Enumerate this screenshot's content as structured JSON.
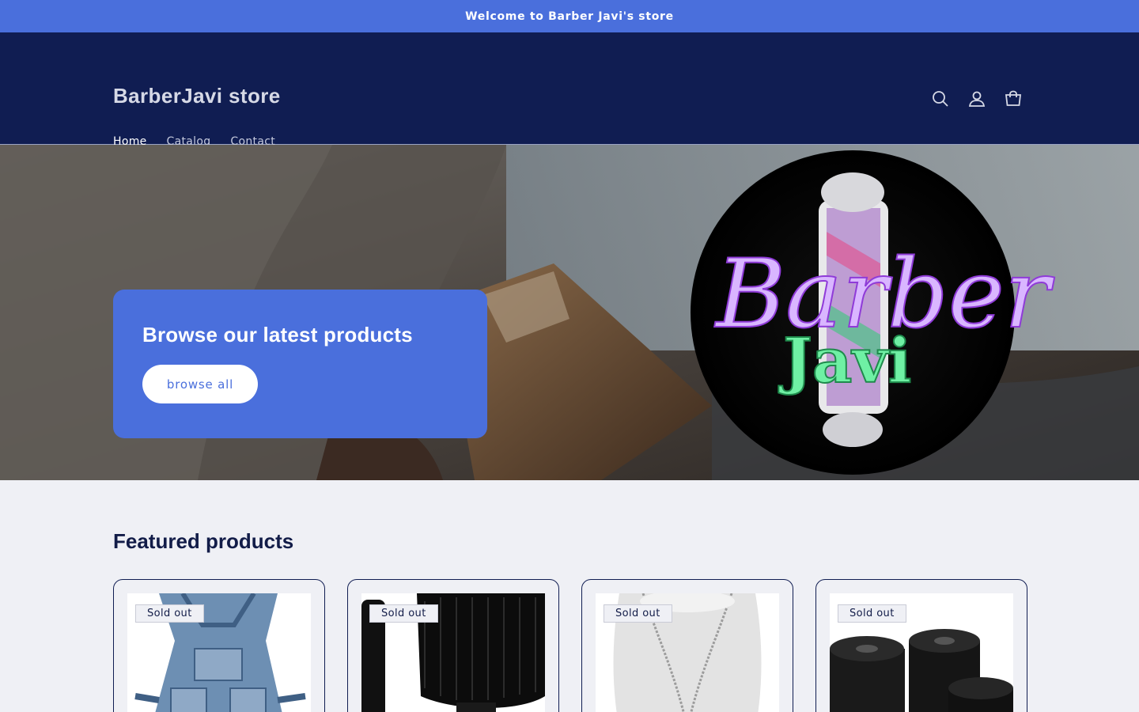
{
  "announcement": {
    "text": "Welcome to Barber Javi's store"
  },
  "header": {
    "logo": "BarberJavi store",
    "nav": [
      {
        "label": "Home",
        "active": true
      },
      {
        "label": "Catalog",
        "active": false
      },
      {
        "label": "Contact",
        "active": false
      }
    ],
    "icons": [
      "search-icon",
      "account-icon",
      "cart-icon"
    ]
  },
  "hero": {
    "heading": "Browse our latest products",
    "button_label": "browse all",
    "logo_script_text": "Barber",
    "logo_name_text": "Javi"
  },
  "featured": {
    "title": "Featured products",
    "products": [
      {
        "badge": "Sold out",
        "image": "denim-apron"
      },
      {
        "badge": "Sold out",
        "image": "neck-duster-brush"
      },
      {
        "badge": "Sold out",
        "image": "chain-necklace"
      },
      {
        "badge": "Sold out",
        "image": "neck-paper-rolls"
      }
    ]
  },
  "colors": {
    "announcement_bg": "#4a6fdc",
    "header_bg": "#101d52",
    "accent": "#4a6fdc",
    "page_bg": "#eff0f5",
    "text_dark": "#121c48"
  }
}
